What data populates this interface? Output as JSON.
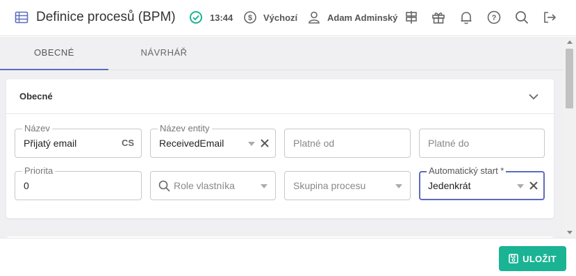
{
  "header": {
    "title": "Definice procesů (BPM)",
    "time": "13:44",
    "currency": "Výchozí",
    "user": "Adam Adminský",
    "icons": [
      "list-icon",
      "check-circle-icon",
      "dollar-circle-icon",
      "user-icon",
      "signpost-icon",
      "gift-icon",
      "bell-icon",
      "help-icon",
      "search-icon",
      "logout-icon"
    ]
  },
  "tabs": [
    {
      "label": "OBECNÉ",
      "active": true
    },
    {
      "label": "NÁVRHÁŘ",
      "active": false
    }
  ],
  "section": {
    "title": "Obecné"
  },
  "fields": {
    "nazev": {
      "label": "Název",
      "value": "Přijatý email",
      "lang": "CS"
    },
    "nazev_entity": {
      "label": "Název entity",
      "value": "ReceivedEmail"
    },
    "platne_od": {
      "placeholder": "Platné od"
    },
    "platne_do": {
      "placeholder": "Platné do"
    },
    "priorita": {
      "label": "Priorita",
      "value": "0"
    },
    "role_vlastnika": {
      "placeholder": "Role vlastníka"
    },
    "skupina_procesu": {
      "placeholder": "Skupina procesu"
    },
    "automaticky_start": {
      "label": "Automatický start *",
      "value": "Jedenkrát"
    }
  },
  "footer": {
    "save_label": "ULOŽIT"
  },
  "colors": {
    "accent": "#5c6bc0",
    "save": "#1ab394",
    "status_ok": "#1ab394"
  }
}
